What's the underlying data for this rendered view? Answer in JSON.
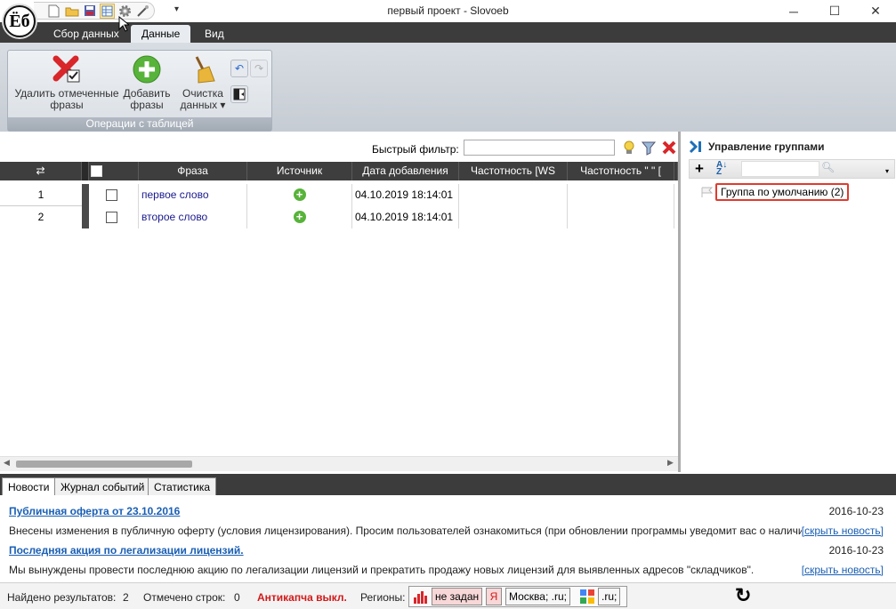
{
  "window": {
    "title": "первый проект - Slovoeb",
    "logo_text": "Ёб",
    "minimize": "─",
    "maximize": "☐",
    "close": "✕"
  },
  "ribbon": {
    "tabs": [
      "Сбор данных",
      "Данные",
      "Вид"
    ],
    "active_tab": "Данные",
    "group_caption": "Операции с таблицей",
    "buttons": {
      "delete_line1": "Удалить отмеченные",
      "delete_line2": "фразы",
      "add_line1": "Добавить",
      "add_line2": "фразы",
      "clear_line1": "Очистка",
      "clear_line2": "данных ▾"
    }
  },
  "filter": {
    "label": "Быстрый фильтр:",
    "value": ""
  },
  "grid": {
    "columns": [
      "Фраза",
      "Источник",
      "Дата добавления",
      "Частотность [WS",
      "Частотность \" \" ["
    ],
    "rows": [
      {
        "num": "1",
        "phrase": "первое слово",
        "date": "04.10.2019 18:14:01"
      },
      {
        "num": "2",
        "phrase": "второе слово",
        "date": "04.10.2019 18:14:01"
      }
    ]
  },
  "groups": {
    "title": "Управление группами",
    "items": [
      "Группа по умолчанию (2)"
    ]
  },
  "bottom_tabs": [
    "Новости",
    "Журнал событий",
    "Статистика"
  ],
  "news": [
    {
      "title": "Публичная оферта от 23.10.2016",
      "date": "2016-10-23",
      "text": "Внесены изменения в публичную оферту (условия лицензирования). Просим пользователей ознакомиться (при обновлении программы уведомит вас о наличии изменений).",
      "link": "[скрыть новость]"
    },
    {
      "title": "Последняя акция по легализации лицензий.",
      "date": "2016-10-23",
      "text": "Мы вынуждены провести последнюю акцию по легализации лицензий и прекратить продажу новых лицензий для выявленных адресов \"складчиков\".",
      "link": "[скрыть новость]"
    }
  ],
  "status": {
    "found_label": "Найдено результатов:",
    "found_value": "2",
    "marked_label": "Отмечено строк:",
    "marked_value": "0",
    "anticaptcha": "Антикапча выкл.",
    "regions_label": "Регионы:",
    "region_ws": "не задан",
    "region_yandex": "Москва; .ru;",
    "region_google": ".ru;"
  },
  "colors": {
    "anticaptcha": "#d11a1a",
    "link": "#1a5fb4",
    "phrase": "#1a1a8c",
    "add_icon": "#58b33a",
    "delete_icon": "#d8262a",
    "highlight_box": "#e03a2e"
  }
}
